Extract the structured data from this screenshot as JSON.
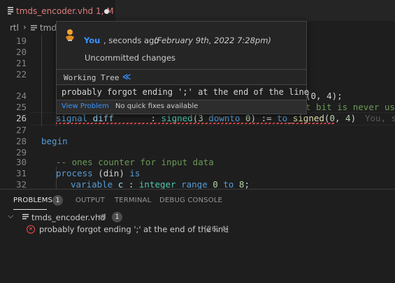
{
  "tab": {
    "filename": "tmds_encoder.vhd",
    "status": "1, M",
    "icon": "vhdl-file-icon"
  },
  "breadcrumb": {
    "folder": "rtl",
    "file": "tmds"
  },
  "editor": {
    "lines": [
      {
        "num": "19"
      },
      {
        "num": "20"
      },
      {
        "num": "21"
      },
      {
        "num": "22"
      },
      {
        "num": "24"
      },
      {
        "num": "25"
      },
      {
        "num": "26"
      },
      {
        "num": "27"
      },
      {
        "num": "28"
      },
      {
        "num": "29"
      },
      {
        "num": "30"
      },
      {
        "num": "31"
      },
      {
        "num": "32"
      }
    ],
    "line24_visible": "(0, 4);",
    "line25_visible": "t bit is never use",
    "line26": {
      "kw_signal": "signal",
      "ident": "diff",
      "colon": ":",
      "type": "signed",
      "open": "(",
      "n3": "3",
      "downto": "downto",
      "n0": "0",
      "assign": ") :=",
      "to": "to",
      "fn": "signed",
      "args_open": "(",
      "a0": "0",
      "comma": ",",
      "a4": "4",
      "close": ")",
      "blame": "You, s"
    },
    "line28": "begin",
    "line30": "-- ones counter for input data",
    "line31": {
      "kw_process": "process",
      "arg": "(din)",
      "kw_is": "is"
    },
    "line32": {
      "kw_variable": "variable",
      "ident": "c",
      "colon": ":",
      "type": "integer",
      "kw_range": "range",
      "n0": "0",
      "kw_to": "to",
      "n8": "8",
      "semi": ";"
    }
  },
  "hover": {
    "author": "You",
    "when": ", seconds ago",
    "date": "(February 9th, 2022 7:28pm)",
    "message": "Uncommitted changes",
    "working_tree": "Working Tree",
    "problem": "probably forgot ending ';' at the end of the line",
    "view_problem": "View Problem",
    "no_fixes": "No quick fixes available"
  },
  "panel": {
    "tabs": [
      {
        "label": "PROBLEMS"
      },
      {
        "label": "OUTPUT"
      },
      {
        "label": "TERMINAL"
      },
      {
        "label": "DEBUG CONSOLE"
      }
    ],
    "problems_count": "1",
    "file": {
      "name": "tmds_encoder.vhd",
      "path": "rtl",
      "count": "1"
    },
    "problem": {
      "text": "probably forgot ending ';' at the end of the line",
      "location": "[26, 4]"
    }
  },
  "colors": {
    "accent": "#3794ff",
    "error": "#f14c4c",
    "modified": "#e07c7c"
  }
}
